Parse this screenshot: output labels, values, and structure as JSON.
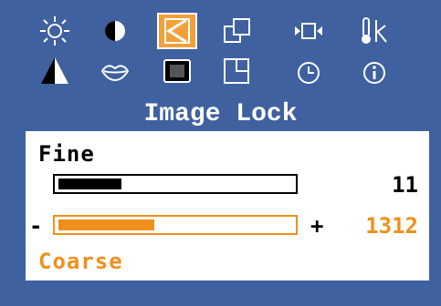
{
  "menu": {
    "icons": [
      {
        "name": "brightness-icon"
      },
      {
        "name": "contrast-icon"
      },
      {
        "name": "image-lock-icon",
        "selected": true
      },
      {
        "name": "position-icon"
      },
      {
        "name": "input-select-icon"
      },
      {
        "name": "temperature-icon"
      },
      {
        "name": "color-icon"
      },
      {
        "name": "lips-icon"
      },
      {
        "name": "pattern-icon"
      },
      {
        "name": "window-icon"
      },
      {
        "name": "clock-icon"
      },
      {
        "name": "info-icon"
      }
    ],
    "title": "Image Lock"
  },
  "fine": {
    "label": "Fine",
    "value": "11",
    "level": 0.27
  },
  "coarse": {
    "label": "Coarse",
    "value": "1312",
    "level": 0.41,
    "minus": "-",
    "plus": "+"
  },
  "colors": {
    "background": "#3f61a0",
    "accent": "#f0901c",
    "panel": "#ffffff"
  }
}
